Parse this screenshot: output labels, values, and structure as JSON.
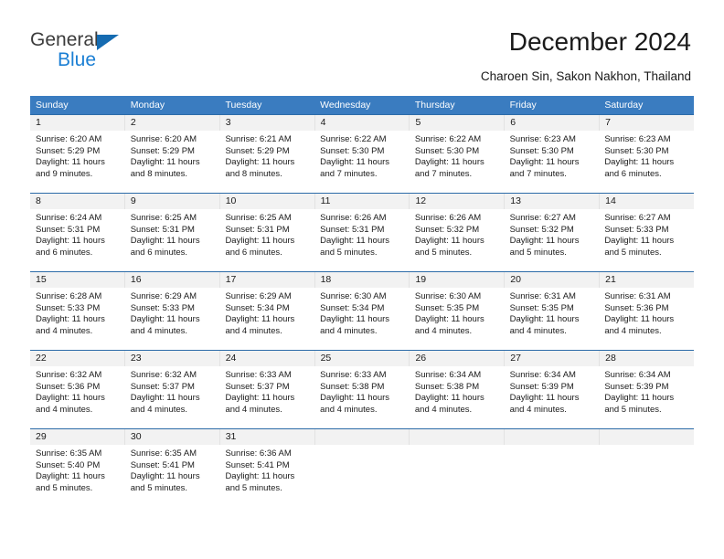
{
  "brand": {
    "name_part1": "General",
    "name_part2": "Blue",
    "triangle_color": "#156bb1",
    "blue_color": "#1b7fd4"
  },
  "header": {
    "title": "December 2024",
    "subtitle": "Charoen Sin, Sakon Nakhon, Thailand"
  },
  "calendar": {
    "header_bg": "#3a7cc0",
    "row_divider_color": "#2c6ba8",
    "daynum_bg": "#f2f2f2",
    "weekdays": [
      "Sunday",
      "Monday",
      "Tuesday",
      "Wednesday",
      "Thursday",
      "Friday",
      "Saturday"
    ],
    "weeks": [
      [
        {
          "day": "1",
          "sunrise": "Sunrise: 6:20 AM",
          "sunset": "Sunset: 5:29 PM",
          "daylight_line1": "Daylight: 11 hours",
          "daylight_line2": "and 9 minutes."
        },
        {
          "day": "2",
          "sunrise": "Sunrise: 6:20 AM",
          "sunset": "Sunset: 5:29 PM",
          "daylight_line1": "Daylight: 11 hours",
          "daylight_line2": "and 8 minutes."
        },
        {
          "day": "3",
          "sunrise": "Sunrise: 6:21 AM",
          "sunset": "Sunset: 5:29 PM",
          "daylight_line1": "Daylight: 11 hours",
          "daylight_line2": "and 8 minutes."
        },
        {
          "day": "4",
          "sunrise": "Sunrise: 6:22 AM",
          "sunset": "Sunset: 5:30 PM",
          "daylight_line1": "Daylight: 11 hours",
          "daylight_line2": "and 7 minutes."
        },
        {
          "day": "5",
          "sunrise": "Sunrise: 6:22 AM",
          "sunset": "Sunset: 5:30 PM",
          "daylight_line1": "Daylight: 11 hours",
          "daylight_line2": "and 7 minutes."
        },
        {
          "day": "6",
          "sunrise": "Sunrise: 6:23 AM",
          "sunset": "Sunset: 5:30 PM",
          "daylight_line1": "Daylight: 11 hours",
          "daylight_line2": "and 7 minutes."
        },
        {
          "day": "7",
          "sunrise": "Sunrise: 6:23 AM",
          "sunset": "Sunset: 5:30 PM",
          "daylight_line1": "Daylight: 11 hours",
          "daylight_line2": "and 6 minutes."
        }
      ],
      [
        {
          "day": "8",
          "sunrise": "Sunrise: 6:24 AM",
          "sunset": "Sunset: 5:31 PM",
          "daylight_line1": "Daylight: 11 hours",
          "daylight_line2": "and 6 minutes."
        },
        {
          "day": "9",
          "sunrise": "Sunrise: 6:25 AM",
          "sunset": "Sunset: 5:31 PM",
          "daylight_line1": "Daylight: 11 hours",
          "daylight_line2": "and 6 minutes."
        },
        {
          "day": "10",
          "sunrise": "Sunrise: 6:25 AM",
          "sunset": "Sunset: 5:31 PM",
          "daylight_line1": "Daylight: 11 hours",
          "daylight_line2": "and 6 minutes."
        },
        {
          "day": "11",
          "sunrise": "Sunrise: 6:26 AM",
          "sunset": "Sunset: 5:31 PM",
          "daylight_line1": "Daylight: 11 hours",
          "daylight_line2": "and 5 minutes."
        },
        {
          "day": "12",
          "sunrise": "Sunrise: 6:26 AM",
          "sunset": "Sunset: 5:32 PM",
          "daylight_line1": "Daylight: 11 hours",
          "daylight_line2": "and 5 minutes."
        },
        {
          "day": "13",
          "sunrise": "Sunrise: 6:27 AM",
          "sunset": "Sunset: 5:32 PM",
          "daylight_line1": "Daylight: 11 hours",
          "daylight_line2": "and 5 minutes."
        },
        {
          "day": "14",
          "sunrise": "Sunrise: 6:27 AM",
          "sunset": "Sunset: 5:33 PM",
          "daylight_line1": "Daylight: 11 hours",
          "daylight_line2": "and 5 minutes."
        }
      ],
      [
        {
          "day": "15",
          "sunrise": "Sunrise: 6:28 AM",
          "sunset": "Sunset: 5:33 PM",
          "daylight_line1": "Daylight: 11 hours",
          "daylight_line2": "and 4 minutes."
        },
        {
          "day": "16",
          "sunrise": "Sunrise: 6:29 AM",
          "sunset": "Sunset: 5:33 PM",
          "daylight_line1": "Daylight: 11 hours",
          "daylight_line2": "and 4 minutes."
        },
        {
          "day": "17",
          "sunrise": "Sunrise: 6:29 AM",
          "sunset": "Sunset: 5:34 PM",
          "daylight_line1": "Daylight: 11 hours",
          "daylight_line2": "and 4 minutes."
        },
        {
          "day": "18",
          "sunrise": "Sunrise: 6:30 AM",
          "sunset": "Sunset: 5:34 PM",
          "daylight_line1": "Daylight: 11 hours",
          "daylight_line2": "and 4 minutes."
        },
        {
          "day": "19",
          "sunrise": "Sunrise: 6:30 AM",
          "sunset": "Sunset: 5:35 PM",
          "daylight_line1": "Daylight: 11 hours",
          "daylight_line2": "and 4 minutes."
        },
        {
          "day": "20",
          "sunrise": "Sunrise: 6:31 AM",
          "sunset": "Sunset: 5:35 PM",
          "daylight_line1": "Daylight: 11 hours",
          "daylight_line2": "and 4 minutes."
        },
        {
          "day": "21",
          "sunrise": "Sunrise: 6:31 AM",
          "sunset": "Sunset: 5:36 PM",
          "daylight_line1": "Daylight: 11 hours",
          "daylight_line2": "and 4 minutes."
        }
      ],
      [
        {
          "day": "22",
          "sunrise": "Sunrise: 6:32 AM",
          "sunset": "Sunset: 5:36 PM",
          "daylight_line1": "Daylight: 11 hours",
          "daylight_line2": "and 4 minutes."
        },
        {
          "day": "23",
          "sunrise": "Sunrise: 6:32 AM",
          "sunset": "Sunset: 5:37 PM",
          "daylight_line1": "Daylight: 11 hours",
          "daylight_line2": "and 4 minutes."
        },
        {
          "day": "24",
          "sunrise": "Sunrise: 6:33 AM",
          "sunset": "Sunset: 5:37 PM",
          "daylight_line1": "Daylight: 11 hours",
          "daylight_line2": "and 4 minutes."
        },
        {
          "day": "25",
          "sunrise": "Sunrise: 6:33 AM",
          "sunset": "Sunset: 5:38 PM",
          "daylight_line1": "Daylight: 11 hours",
          "daylight_line2": "and 4 minutes."
        },
        {
          "day": "26",
          "sunrise": "Sunrise: 6:34 AM",
          "sunset": "Sunset: 5:38 PM",
          "daylight_line1": "Daylight: 11 hours",
          "daylight_line2": "and 4 minutes."
        },
        {
          "day": "27",
          "sunrise": "Sunrise: 6:34 AM",
          "sunset": "Sunset: 5:39 PM",
          "daylight_line1": "Daylight: 11 hours",
          "daylight_line2": "and 4 minutes."
        },
        {
          "day": "28",
          "sunrise": "Sunrise: 6:34 AM",
          "sunset": "Sunset: 5:39 PM",
          "daylight_line1": "Daylight: 11 hours",
          "daylight_line2": "and 5 minutes."
        }
      ],
      [
        {
          "day": "29",
          "sunrise": "Sunrise: 6:35 AM",
          "sunset": "Sunset: 5:40 PM",
          "daylight_line1": "Daylight: 11 hours",
          "daylight_line2": "and 5 minutes."
        },
        {
          "day": "30",
          "sunrise": "Sunrise: 6:35 AM",
          "sunset": "Sunset: 5:41 PM",
          "daylight_line1": "Daylight: 11 hours",
          "daylight_line2": "and 5 minutes."
        },
        {
          "day": "31",
          "sunrise": "Sunrise: 6:36 AM",
          "sunset": "Sunset: 5:41 PM",
          "daylight_line1": "Daylight: 11 hours",
          "daylight_line2": "and 5 minutes."
        },
        {
          "day": "",
          "sunrise": "",
          "sunset": "",
          "daylight_line1": "",
          "daylight_line2": ""
        },
        {
          "day": "",
          "sunrise": "",
          "sunset": "",
          "daylight_line1": "",
          "daylight_line2": ""
        },
        {
          "day": "",
          "sunrise": "",
          "sunset": "",
          "daylight_line1": "",
          "daylight_line2": ""
        },
        {
          "day": "",
          "sunrise": "",
          "sunset": "",
          "daylight_line1": "",
          "daylight_line2": ""
        }
      ]
    ]
  }
}
